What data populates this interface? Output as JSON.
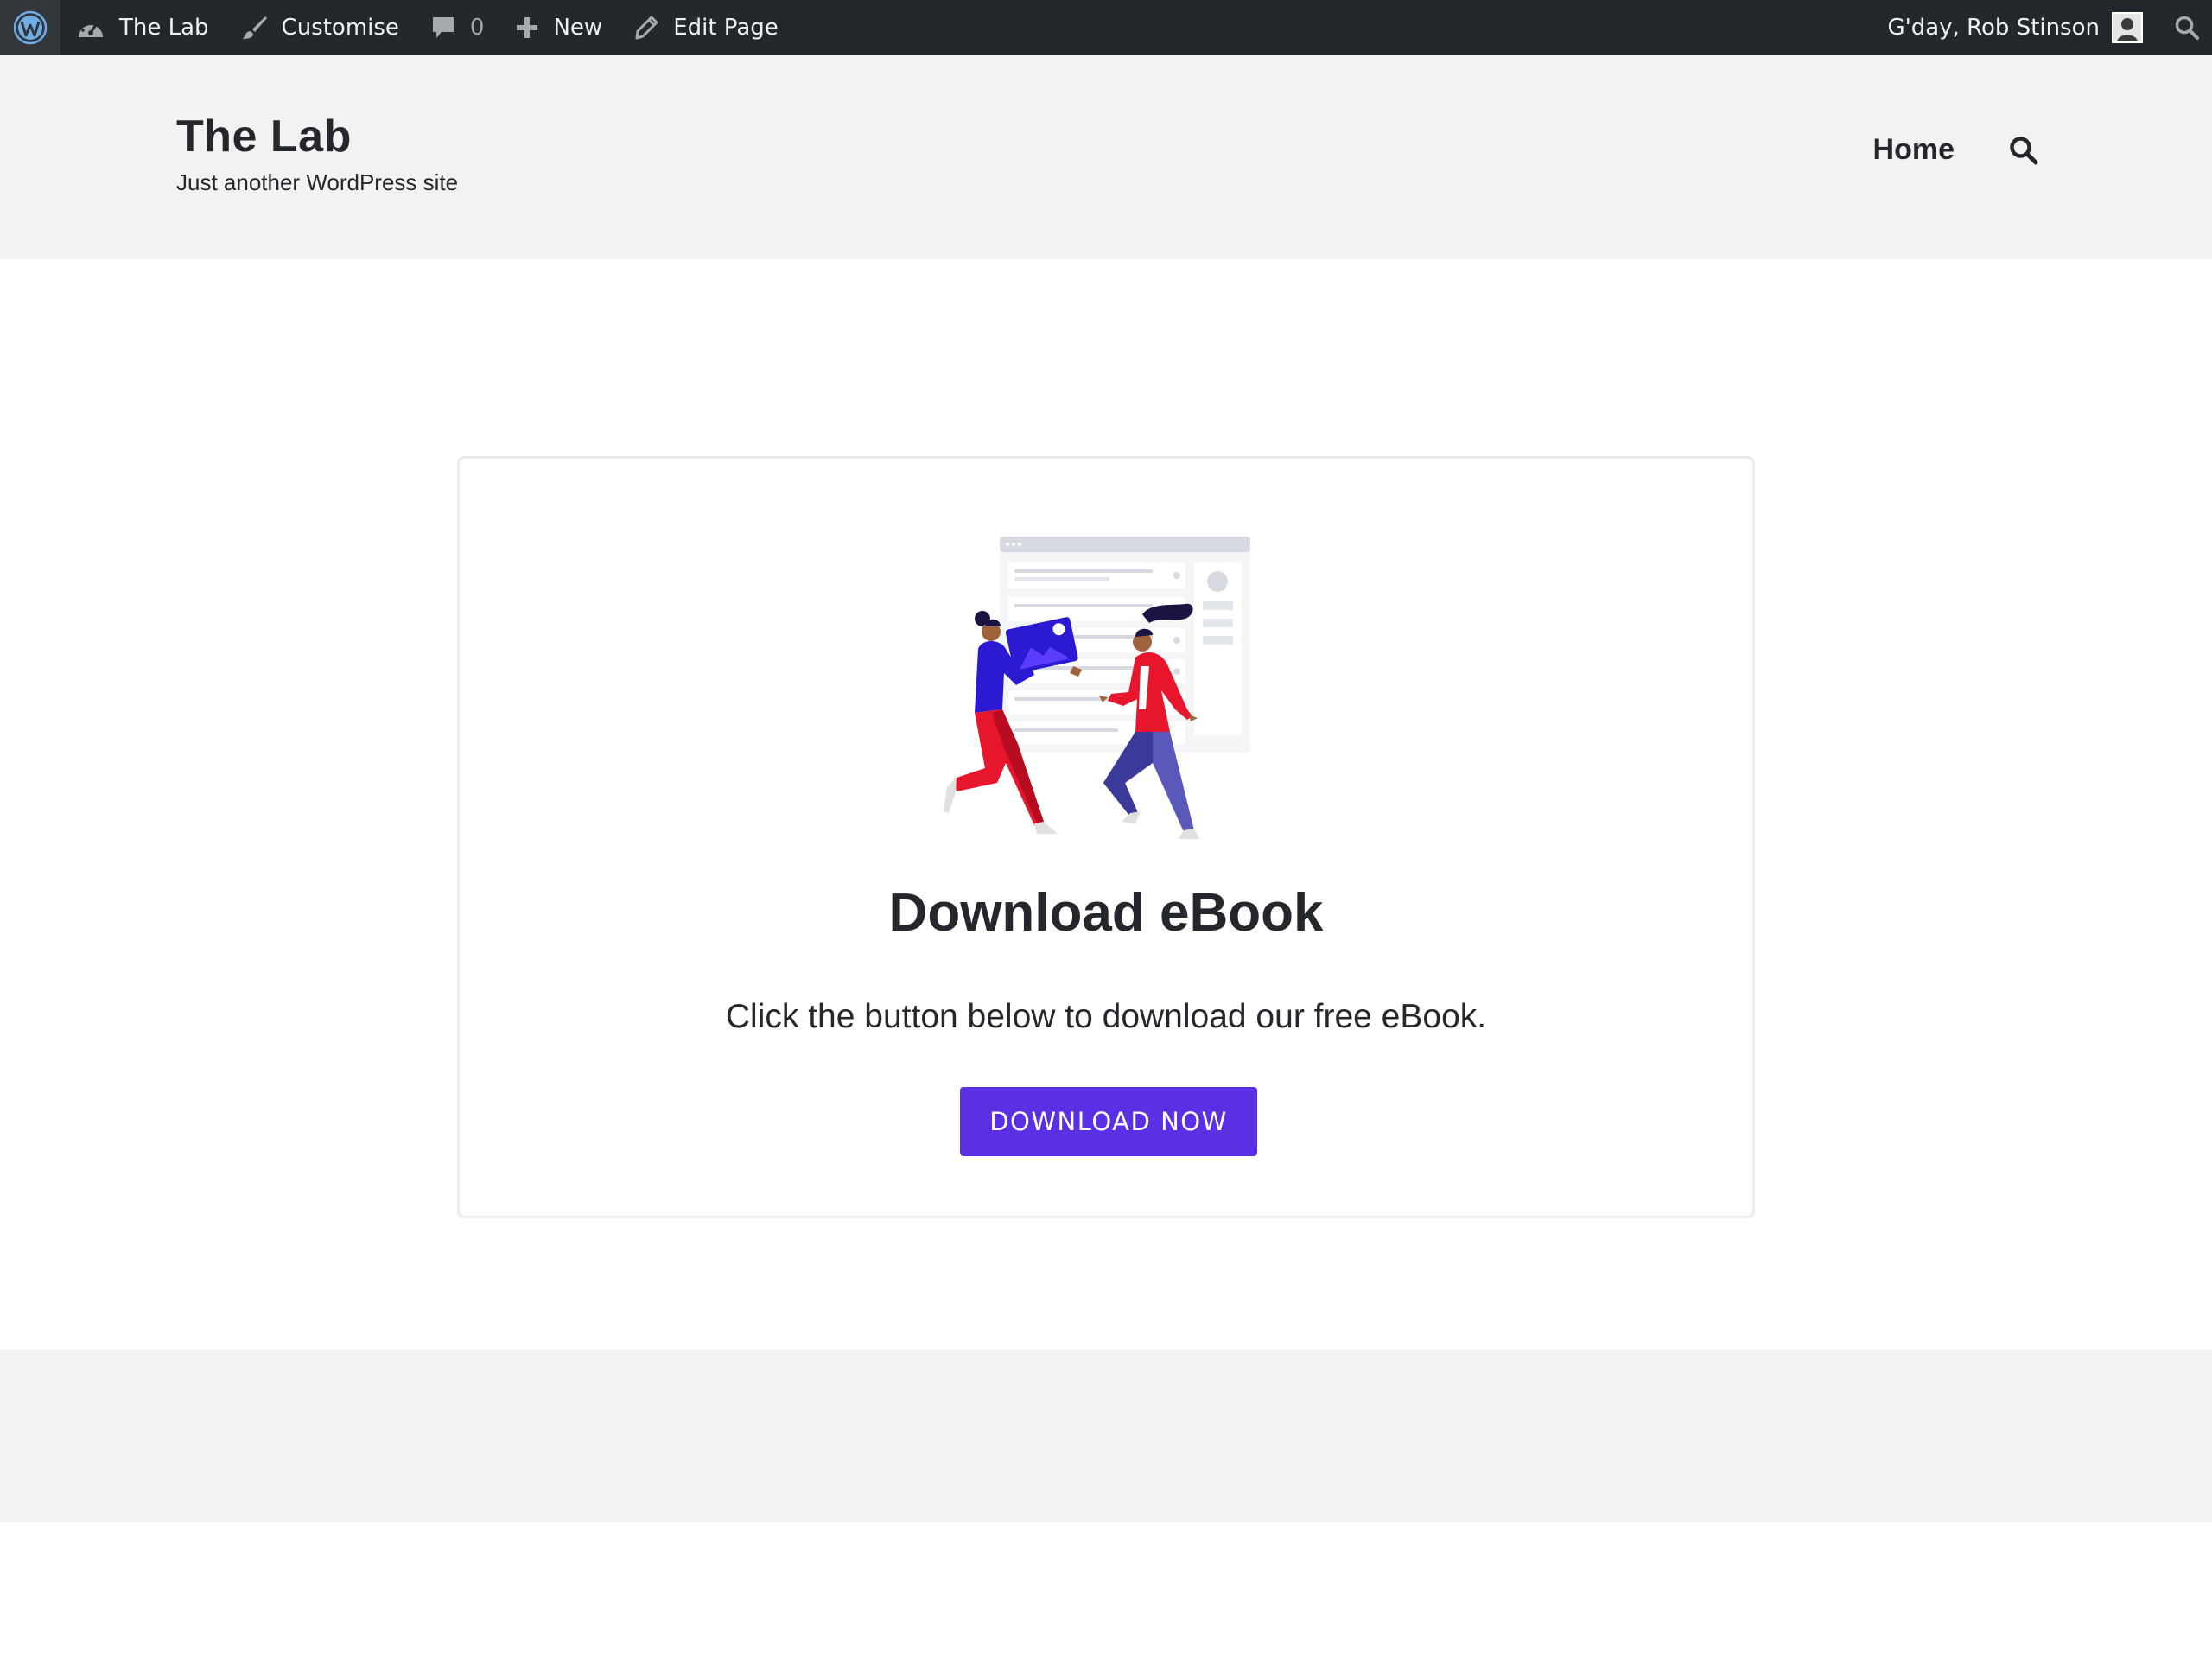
{
  "admin_bar": {
    "wp_logo_icon": "wordpress-logo-icon",
    "site_name": "The Lab",
    "customise": "Customise",
    "comments_count": "0",
    "new_label": "New",
    "edit_page": "Edit Page",
    "greeting": "G'day, Rob Stinson"
  },
  "header": {
    "site_title": "The Lab",
    "tagline": "Just another WordPress site",
    "nav": {
      "home": "Home"
    }
  },
  "card": {
    "title": "Download eBook",
    "text": "Click the button below to download our free eBook.",
    "button_label": "DOWNLOAD NOW"
  },
  "colors": {
    "admin_bar_bg": "#23282d",
    "header_bg": "#f2f2f2",
    "button_bg": "#5b2fe3",
    "text": "#24282d"
  }
}
